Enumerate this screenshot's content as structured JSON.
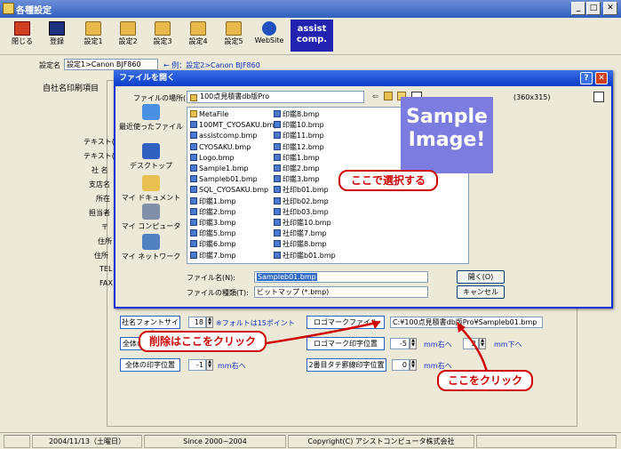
{
  "window": {
    "title": "各種設定",
    "min": "_",
    "max": "□",
    "close": "✕"
  },
  "toolbar": {
    "items": [
      {
        "label": "閉じる"
      },
      {
        "label": "登録"
      },
      {
        "label": "設定1"
      },
      {
        "label": "設定2"
      },
      {
        "label": "設定3"
      },
      {
        "label": "設定4"
      },
      {
        "label": "設定5"
      },
      {
        "label": "WebSite"
      }
    ],
    "assist_line1": "assist",
    "assist_line2": "comp."
  },
  "settings": {
    "name_label": "設定名",
    "name_value": "設定1>Canon BJF860",
    "name_hint": "← 例：設定2>Canon BJF860",
    "tab_label": "自社名印刷項目"
  },
  "side_labels": [
    "テキスト(",
    "テキスト(",
    "社 名",
    "支店名",
    "所在",
    "担当者",
    "〒",
    "住所",
    "住所",
    "TEL",
    "FAX"
  ],
  "lower_panel": {
    "font_size_button": "社名フォントサイズ",
    "font_size_value": "18",
    "font_size_note": "※フォルトは15ポイント",
    "all_pos_button": "全体の",
    "all_print_pos_button": "全体の印字位置",
    "all_print_pos_value": "-1",
    "all_print_pos_unit": "mm右へ",
    "logo_file_button": "ロゴマークファイル",
    "logo_file_path": "C:¥100点見積書db版Pro¥Sampleb01.bmp",
    "logo_pos_button": "ロゴマーク印字位置",
    "logo_pos_x": "-5",
    "logo_pos_x_unit": "mm右へ",
    "logo_pos_y": "2",
    "logo_pos_y_unit": "mm下へ",
    "second_line_button": "2番目タテ罫線印字位置",
    "second_line_value": "0",
    "second_line_unit": "mm右へ"
  },
  "dialog": {
    "title": "ファイルを開く",
    "help": "?",
    "close": "✕",
    "lookin_label": "ファイルの場所(I):",
    "lookin_value": "100点見積書db版Pro",
    "preview_size": "(360x315)",
    "places": [
      "最近使ったファイル",
      "デスクトップ",
      "マイ ドキュメント",
      "マイ コンピュータ",
      "マイ ネットワーク"
    ],
    "files_col1": [
      "MetaFile",
      "100MT_CYOSAKU.bmp",
      "assistcomp.bmp",
      "CYOSAKU.bmp",
      "Logo.bmp",
      "Sample1.bmp",
      "Sampleb01.bmp",
      "SQL_CYOSAKU.bmp",
      "印鑑1.bmp",
      "印鑑2.bmp",
      "印鑑3.bmp",
      "印鑑5.bmp",
      "印鑑6.bmp",
      "印鑑7.bmp"
    ],
    "files_col2": [
      "印鑑8.bmp",
      "印鑑10.bmp",
      "印鑑11.bmp",
      "印鑑12.bmp",
      "印鑑1.bmp",
      "印鑑2.bmp",
      "印鑑3.bmp",
      "社印b01.bmp",
      "社印b02.bmp",
      "社印b03.bmp",
      "社印鑑10.bmp",
      "社印鑑7.bmp",
      "社印鑑8.bmp",
      "社印鑑b01.bmp"
    ],
    "filename_label": "ファイル名(N):",
    "filename_value": "Sampleb01.bmp",
    "filetype_label": "ファイルの種類(T):",
    "filetype_value": "ビットマップ (*.bmp)",
    "open_button": "開く(O)",
    "cancel_button": "キャンセル",
    "preview_line1": "Sample",
    "preview_line2": "Image!"
  },
  "callouts": {
    "select": "ここで選択する",
    "delete": "削除はここをクリック",
    "click": "ここをクリック"
  },
  "statusbar": {
    "date": "2004/11/13（土曜日）",
    "since": "Since 2000~2004",
    "copyright": "Copyright(C) アシストコンピュータ株式会社"
  },
  "colors": {
    "accent": "#0a3cc8",
    "callout": "#d00000",
    "preview": "#7c7ce0"
  }
}
